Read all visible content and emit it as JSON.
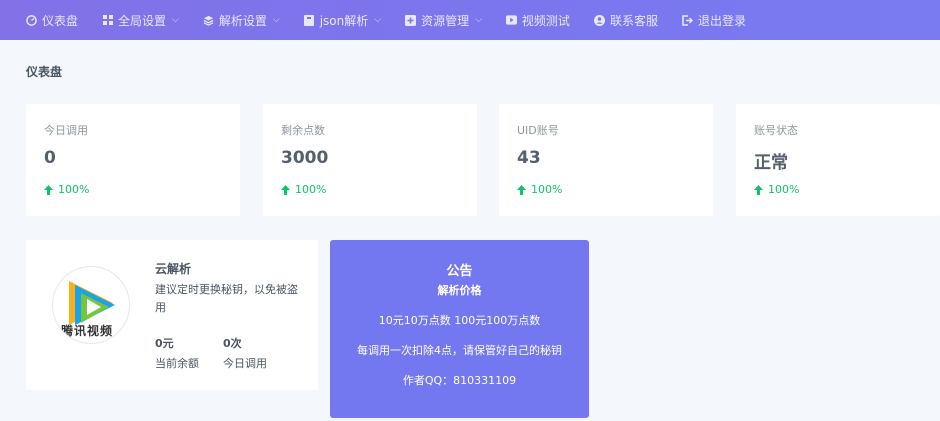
{
  "nav": {
    "items": [
      {
        "label": "仪表盘",
        "icon": "dashboard-icon",
        "dropdown": false
      },
      {
        "label": "全局设置",
        "icon": "grid-icon",
        "dropdown": true
      },
      {
        "label": "解析设置",
        "icon": "layers-icon",
        "dropdown": true
      },
      {
        "label": "json解析",
        "icon": "book-icon",
        "dropdown": true
      },
      {
        "label": "资源管理",
        "icon": "plus-square-icon",
        "dropdown": true
      },
      {
        "label": "视频测试",
        "icon": "video-icon",
        "dropdown": false
      },
      {
        "label": "联系客服",
        "icon": "user-circle-icon",
        "dropdown": false
      },
      {
        "label": "退出登录",
        "icon": "logout-icon",
        "dropdown": false
      }
    ]
  },
  "page_title": "仪表盘",
  "stats": [
    {
      "label": "今日调用",
      "value": "0",
      "trend": "100%"
    },
    {
      "label": "剩余点数",
      "value": "3000",
      "trend": "100%"
    },
    {
      "label": "UID账号",
      "value": "43",
      "trend": "100%"
    },
    {
      "label": "账号状态",
      "value": "正常",
      "trend": "100%"
    }
  ],
  "profile": {
    "logo_text": "腾讯视频",
    "title": "云解析",
    "description": "建议定时更换秘钥，以免被盗用",
    "balance_value": "0元",
    "balance_label": "当前余额",
    "calls_value": "0次",
    "calls_label": "今日调用"
  },
  "notice": {
    "title": "公告",
    "subtitle": "解析价格",
    "line1": "10元10万点数 100元100万点数",
    "line2": "每调用一次扣除4点，请保管好自己的秘钥",
    "line3": "作者QQ：810331109"
  },
  "colors": {
    "topbar": "#7b76ee",
    "trend_green": "#10c469",
    "notice_bg": "#7478f0",
    "page_bg": "#f4f7fb"
  }
}
